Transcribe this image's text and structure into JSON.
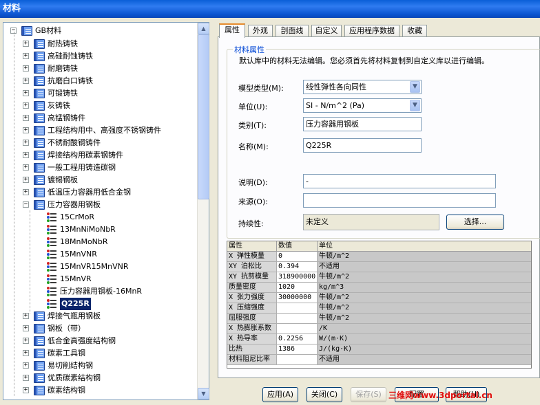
{
  "window": {
    "title": "材料"
  },
  "tree": {
    "root": "GB材料",
    "categories_top": [
      "耐热铸铁",
      "高硅耐蚀铸铁",
      "耐磨铸铁",
      "抗磨白口铸铁",
      "可锻铸铁",
      "灰铸铁",
      "高锰钢铸件",
      "工程结构用中、高强度不锈钢铸件",
      "不锈耐酸钢铸件",
      "焊接结构用碳素钢铸件",
      "一般工程用铸造碳钢",
      "镀锡钢板",
      "低温压力容器用低合金钢"
    ],
    "expanded_category": "压力容器用钢板",
    "materials": [
      "15CrMoR",
      "13MnNiMoNbR",
      "18MnMoNbR",
      "15MnVNR",
      "15MnVR15MnVNR",
      "15MnVR",
      "压力容器用钢板-16MnR",
      "Q225R"
    ],
    "categories_bottom": [
      "焊接气瓶用钢板",
      "钢板（带）",
      "低合金高强度结构钢",
      "碳素工具钢",
      "易切削结构钢",
      "优质碳素结构钢",
      "碳素结构钢"
    ],
    "expand_plus": "+",
    "expand_minus": "−"
  },
  "tabs": [
    "属性",
    "外观",
    "剖面线",
    "自定义",
    "应用程序数据",
    "收藏"
  ],
  "properties": {
    "group_title": "材料属性",
    "notice": "默认库中的材料无法编辑。您必须首先将材料复制到自定义库以进行编辑。",
    "model_type_label": "模型类型(M):",
    "model_type_value": "线性弹性各向同性",
    "unit_label": "单位(U):",
    "unit_value": "SI - N/m^2 (Pa)",
    "category_label": "类别(T):",
    "category_value": "压力容器用钢板",
    "name_label": "名称(M):",
    "name_value": "Q225R",
    "desc_label": "说明(D):",
    "desc_value": "-",
    "source_label": "来源(O):",
    "source_value": "",
    "sustain_label": "持续性:",
    "sustain_value": "未定义",
    "select_button": "选择..."
  },
  "table": {
    "headers": [
      "属性",
      "数值",
      "单位"
    ],
    "rows": [
      [
        "X 弹性模量",
        "0",
        "牛顿/m^2"
      ],
      [
        "XY 泊松比",
        "0.394",
        "不适用"
      ],
      [
        "XY 抗剪模量",
        "318900000",
        "牛顿/m^2"
      ],
      [
        "质量密度",
        "1020",
        "kg/m^3"
      ],
      [
        "X 张力强度",
        "30000000",
        "牛顿/m^2"
      ],
      [
        "X 压缩强度",
        "",
        "牛顿/m^2"
      ],
      [
        "屈服强度",
        "",
        "牛顿/m^2"
      ],
      [
        "X 热膨胀系数",
        "",
        "/K"
      ],
      [
        "X 热导率",
        "0.2256",
        "W/(m·K)"
      ],
      [
        "比热",
        "1386",
        "J/(kg·K)"
      ],
      [
        "材料阻尼比率",
        "",
        "不适用"
      ]
    ]
  },
  "buttons": {
    "apply": "应用(A)",
    "close": "关闭(C)",
    "save": "保存(S)",
    "config": "配置",
    "help": "帮助(H)"
  },
  "watermark": "三维网www.3dportal.cn",
  "icons": {
    "scroll_up": "▲",
    "scroll_down": "▼",
    "combo_arrow": "▼"
  }
}
